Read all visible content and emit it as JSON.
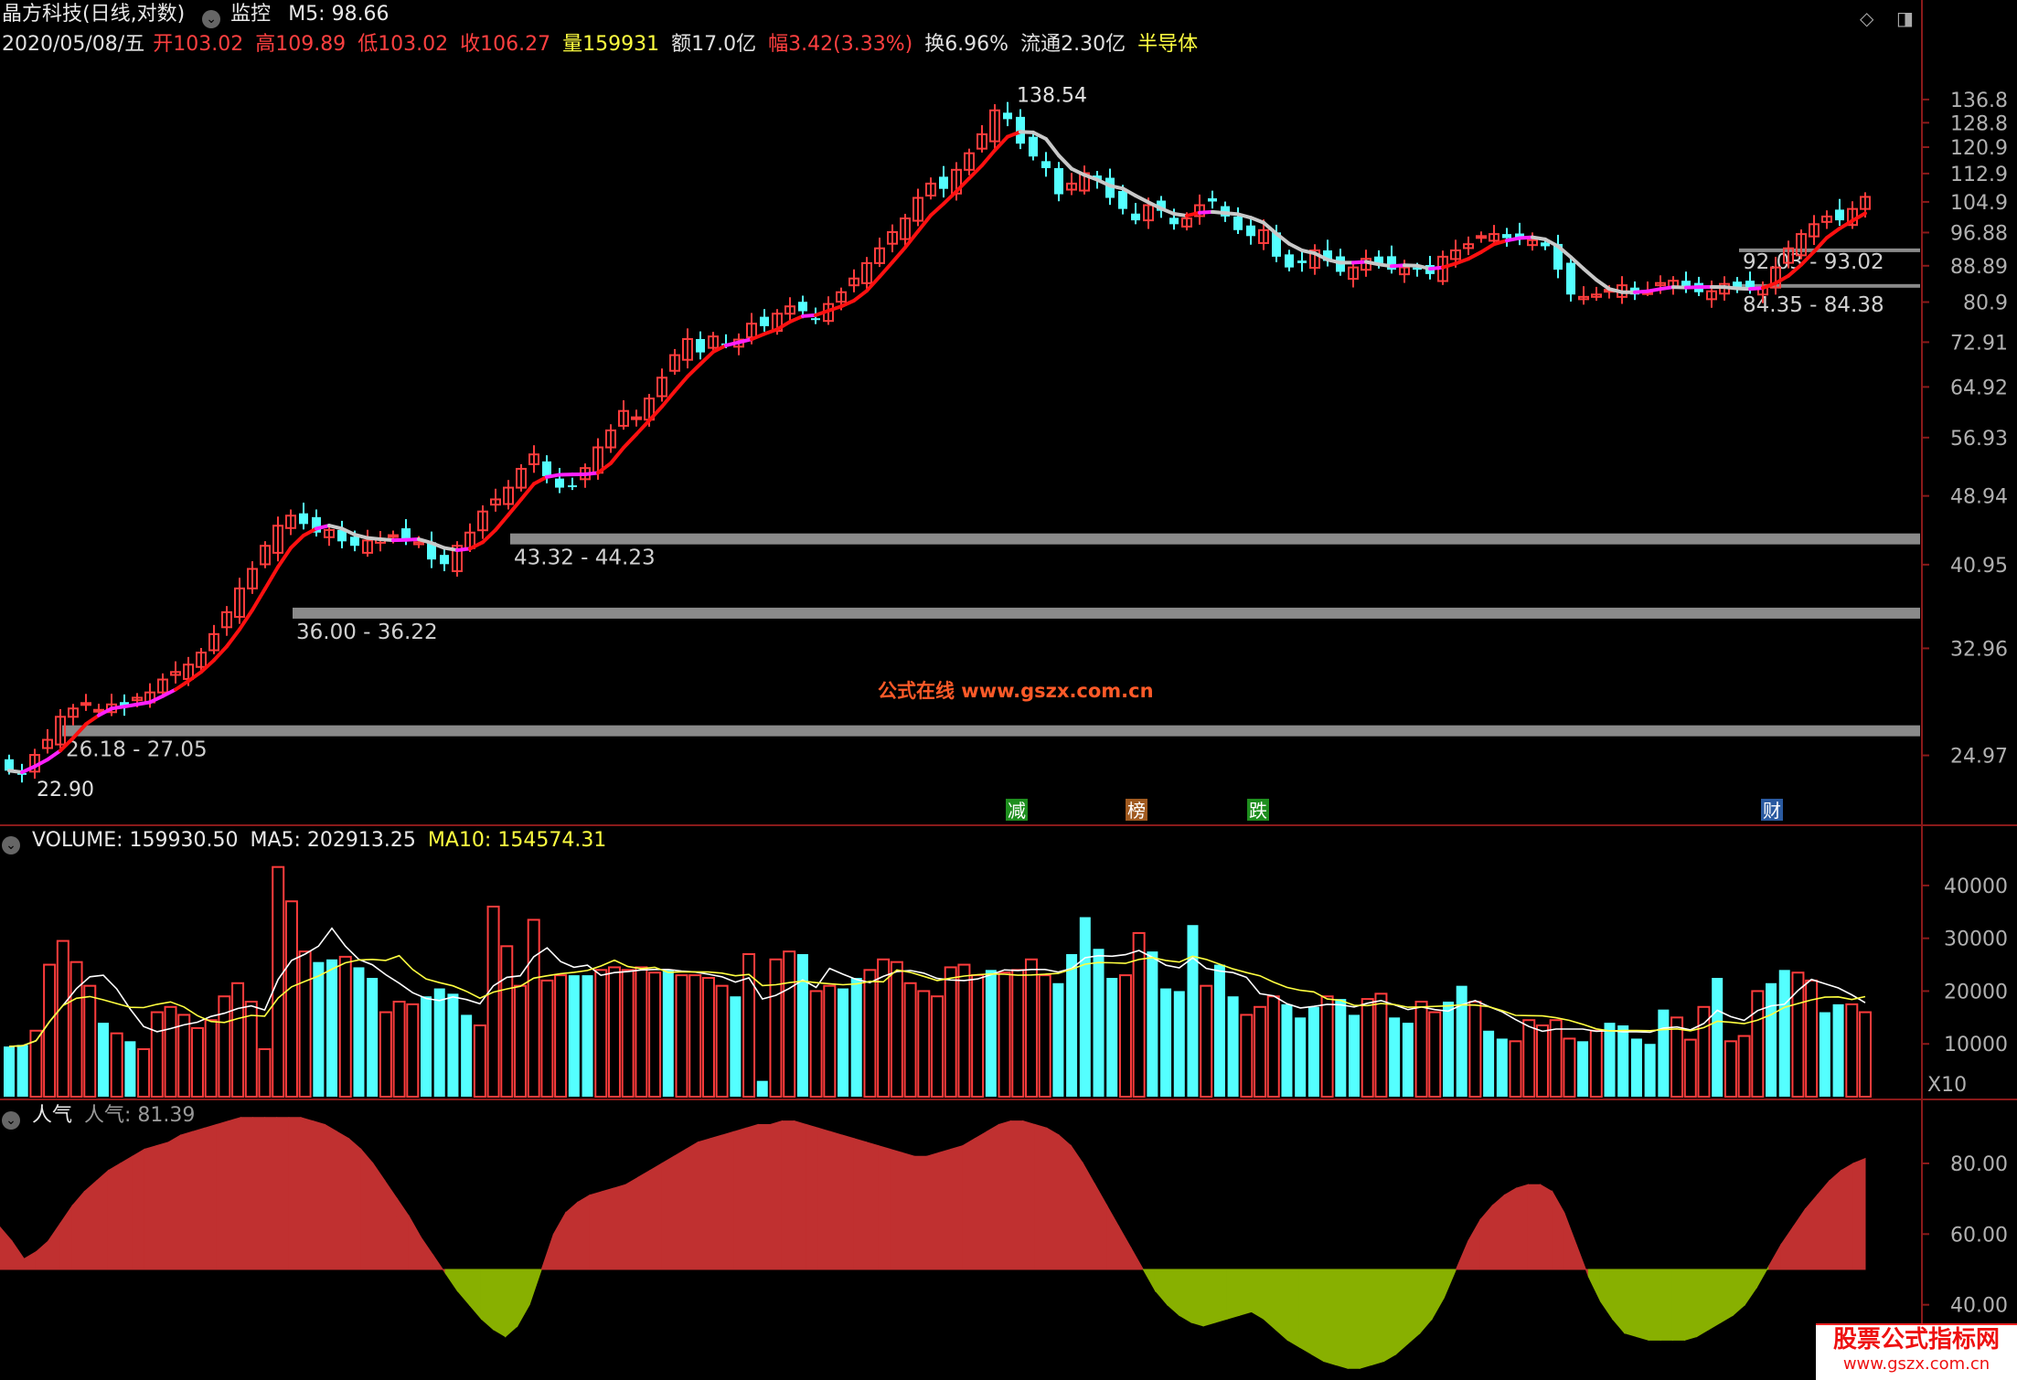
{
  "header": {
    "stock_title": "晶方科技(日线,对数)",
    "monitor_label": "监控",
    "m5_label": "M5: 98.66",
    "date": "2020/05/08/五",
    "open": "开103.02",
    "high": "高109.89",
    "low": "低103.02",
    "close": "收106.27",
    "volume": "量159931",
    "amount": "额17.0亿",
    "amplitude": "幅3.42(3.33%)",
    "turnover": "换6.96%",
    "float": "流通2.30亿",
    "sector": "半导体"
  },
  "volume_header": {
    "volume": "VOLUME: 159930.50",
    "ma5": "MA5: 202913.25",
    "ma10": "MA10: 154574.31"
  },
  "indicator_header": {
    "name": "人气",
    "value": "人气: 81.39"
  },
  "watermark": "公式在线  www.gszx.com.cn",
  "corner_logo": {
    "line1": "股票公式指标网",
    "line2": "www.gszx.com.cn"
  },
  "colors": {
    "up": "#ff3c3c",
    "down": "#54ffff",
    "ma_up": "#ff1010",
    "ma_mid": "#ff20ff",
    "ma_down": "#c8c8c8",
    "vol_ma5": "#ffffff",
    "vol_ma10": "#ffff40",
    "pos_area": "#c03030",
    "neg_area": "#88b000",
    "zone": "#8a8a8a"
  },
  "chart_data": [
    {
      "type": "candlestick",
      "scale": "log",
      "ylim": [
        22,
        150
      ],
      "y_ticks": [
        136.8,
        128.8,
        120.9,
        112.9,
        104.9,
        96.88,
        88.89,
        80.9,
        72.91,
        64.92,
        56.93,
        48.94,
        40.95,
        32.96,
        24.97
      ],
      "annotations": {
        "high_label": "138.54",
        "low_label": "22.90"
      },
      "zones": [
        {
          "label": "26.18 - 27.05",
          "low": 26.18,
          "high": 27.05
        },
        {
          "label": "36.00 - 36.22",
          "low": 36.0,
          "high": 36.22
        },
        {
          "label": "43.32 - 44.23",
          "low": 43.32,
          "high": 44.23
        },
        {
          "label": "84.35 - 84.38",
          "low": 84.35,
          "high": 84.38
        },
        {
          "label": "92.03 - 93.02",
          "low": 92.03,
          "high": 93.02
        }
      ],
      "event_markers": [
        "减",
        "榜",
        "跌",
        "财"
      ],
      "close": [
        24.0,
        23.8,
        25.0,
        26.0,
        27.6,
        28.2,
        28.6,
        28.1,
        28.5,
        28.3,
        29.0,
        29.4,
        30.4,
        31.0,
        31.6,
        32.6,
        34.2,
        36.2,
        38.5,
        40.5,
        43.0,
        45.3,
        46.5,
        45.5,
        44.5,
        44.8,
        43.5,
        43.0,
        43.6,
        43.8,
        44.2,
        43.7,
        43.4,
        41.5,
        41.0,
        43.0,
        44.5,
        47.0,
        48.5,
        50.0,
        52.5,
        54.5,
        51.5,
        50.0,
        50.2,
        52.6,
        55.5,
        58.0,
        61.0,
        60.0,
        63.0,
        66.5,
        70.5,
        73.5,
        71.0,
        74.0,
        72.5,
        73.4,
        76.5,
        76.0,
        78.5,
        80.0,
        79.0,
        77.5,
        80.5,
        83.0,
        86.0,
        89.5,
        93.0,
        97.0,
        100.5,
        106.0,
        110.0,
        108.5,
        114.0,
        119.0,
        125.0,
        133.0,
        130.0,
        122.0,
        118.0,
        114.5,
        107.0,
        110.0,
        113.0,
        111.0,
        106.0,
        103.0,
        100.0,
        104.0,
        102.5,
        99.0,
        100.5,
        104.0,
        105.0,
        101.0,
        97.5,
        96.0,
        97.5,
        91.0,
        88.5,
        89.5,
        92.5,
        90.0,
        87.5,
        88.5,
        90.5,
        89.5,
        88.0,
        88.5,
        88.0,
        87.0,
        91.0,
        92.5,
        94.0,
        96.0,
        96.5,
        95.5,
        95.5,
        95.0,
        93.5,
        88.0,
        82.5,
        82.0,
        82.5,
        83.5,
        84.5,
        82.5,
        83.0,
        85.0,
        85.5,
        84.0,
        83.0,
        83.2,
        84.8,
        84.0,
        83.5,
        84.0,
        88.5,
        93.0,
        96.5,
        99.0,
        101.0,
        100.0,
        103.0,
        106.27
      ],
      "volume": [
        9500,
        9800,
        12500,
        25000,
        29500,
        25500,
        21000,
        14000,
        12000,
        10500,
        9000,
        16000,
        17000,
        15500,
        13000,
        14500,
        19000,
        21500,
        18000,
        9000,
        43500,
        37000,
        27500,
        25500,
        26000,
        26500,
        24500,
        22500,
        16000,
        18000,
        17500,
        19000,
        20500,
        19500,
        15500,
        13500,
        36000,
        28500,
        21000,
        33500,
        22000,
        23000,
        23000,
        23000,
        24000,
        24500,
        24000,
        24500,
        23500,
        24000,
        23000,
        23000,
        22500,
        21000,
        19000,
        27000,
        3000,
        26000,
        27500,
        27000,
        20000,
        21000,
        20500,
        22500,
        24000,
        26000,
        25500,
        21500,
        20000,
        19000,
        24500,
        25000,
        23000,
        24000,
        23500,
        24000,
        26000,
        23000,
        21500,
        27000,
        34000,
        28000,
        22500,
        23000,
        31000,
        27500,
        20500,
        20000,
        32500,
        21000,
        25000,
        19000,
        15500,
        17000,
        19000,
        17500,
        15000,
        17000,
        19000,
        18500,
        15500,
        18500,
        19500,
        15000,
        14000,
        18000,
        16000,
        18000,
        21000,
        18000,
        12500,
        11000,
        10500,
        14500,
        13500,
        14500,
        11000,
        10500,
        12500,
        14000,
        13500,
        11000,
        10000,
        16500,
        15000,
        10800,
        17000,
        22500,
        10500,
        11500,
        20000,
        21500,
        24000,
        23500,
        22000,
        16000,
        17500,
        17500,
        16000
      ],
      "volume_ylim": [
        0,
        45000
      ],
      "volume_ticks": [
        40000,
        30000,
        20000,
        10000
      ],
      "volume_unit": "X10",
      "renqi": [
        62,
        58,
        53,
        55,
        58,
        63,
        68,
        72,
        75,
        78,
        80,
        82,
        84,
        85,
        86,
        88,
        89,
        90,
        91,
        92,
        93,
        93,
        93,
        93,
        93,
        93,
        92,
        91,
        89,
        87,
        84,
        80,
        75,
        70,
        65,
        59,
        54,
        49,
        44,
        40,
        36,
        33,
        31,
        34,
        40,
        50,
        60,
        66,
        69,
        71,
        72,
        73,
        74,
        76,
        78,
        80,
        82,
        84,
        86,
        87,
        88,
        89,
        90,
        91,
        91,
        92,
        92,
        91,
        90,
        89,
        88,
        87,
        86,
        85,
        84,
        83,
        82,
        82,
        83,
        84,
        85,
        87,
        89,
        91,
        92,
        92,
        91,
        90,
        88,
        85,
        80,
        74,
        68,
        62,
        56,
        50,
        44,
        40,
        37,
        35,
        34,
        35,
        36,
        37,
        38,
        36,
        33,
        30,
        28,
        26,
        24,
        23,
        22,
        22,
        23,
        24,
        26,
        29,
        32,
        36,
        42,
        50,
        58,
        64,
        68,
        71,
        73,
        74,
        74,
        72,
        66,
        57,
        48,
        41,
        36,
        32,
        31,
        30,
        30,
        30,
        30,
        31,
        33,
        35,
        37,
        40,
        45,
        51,
        57,
        62,
        67,
        71,
        75,
        78,
        80,
        81.39
      ],
      "renqi_ylim": [
        20,
        95
      ],
      "renqi_ticks": [
        80.0,
        60.0,
        40.0
      ],
      "renqi_baseline": 50
    }
  ]
}
